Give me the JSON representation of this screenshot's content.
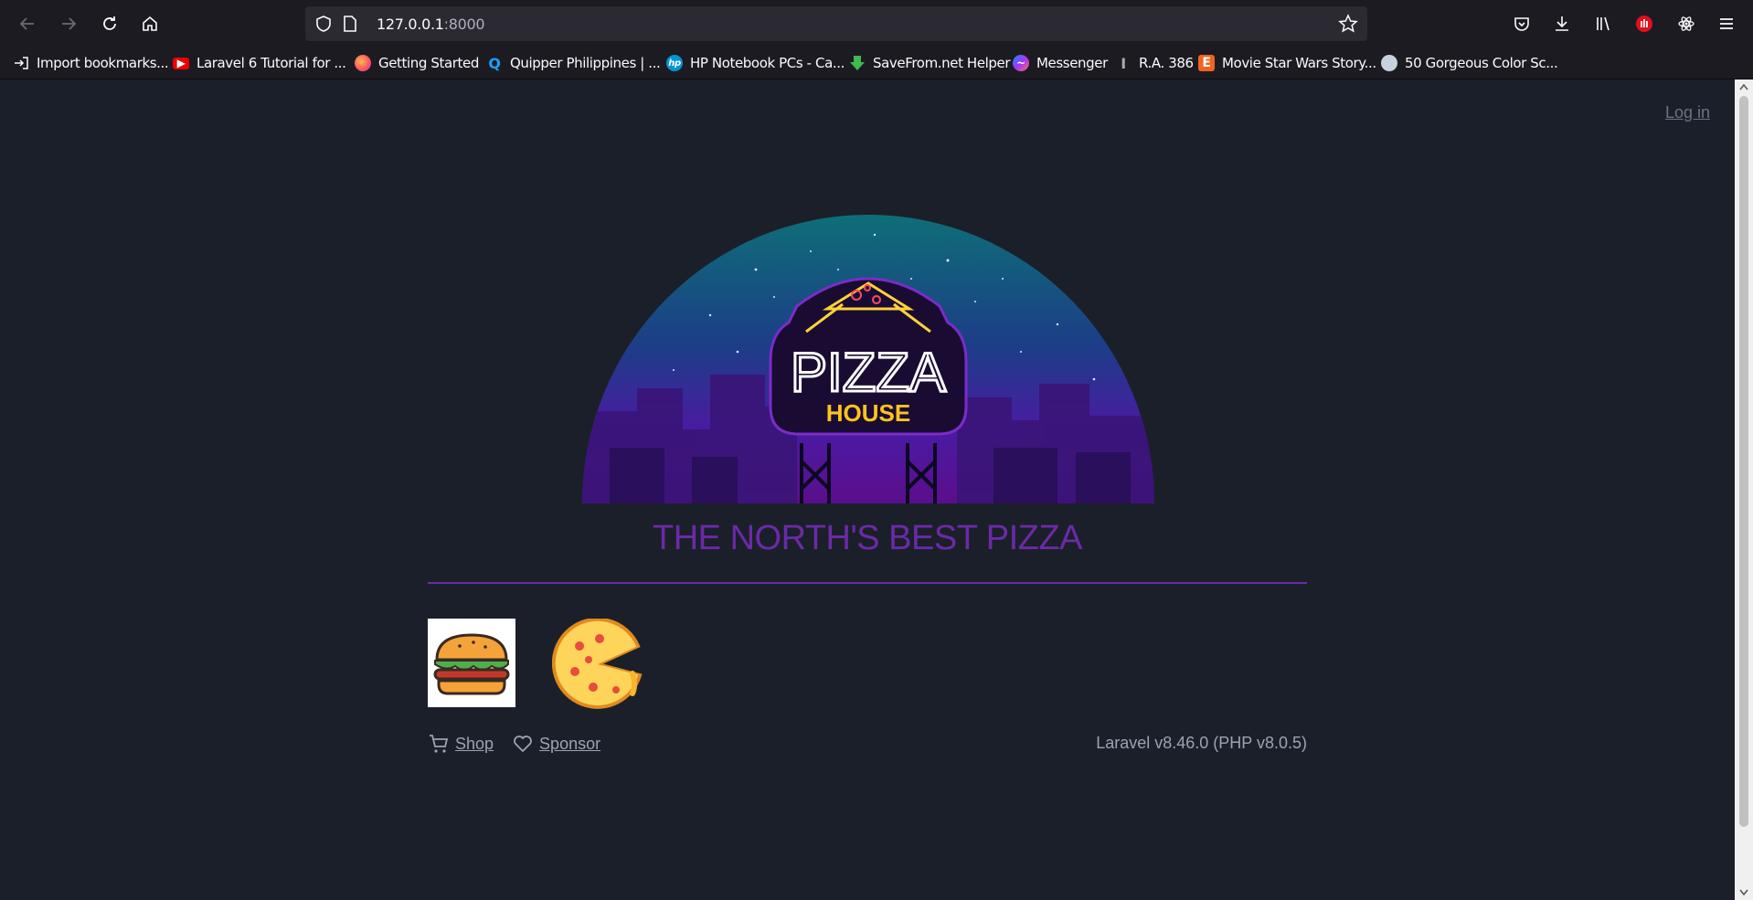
{
  "browser": {
    "url_host": "127.0.0.1",
    "url_port": ":8000",
    "bookmarks": [
      {
        "label": "Import bookmarks...",
        "icon": "import-icon"
      },
      {
        "label": "Laravel 6 Tutorial for ...",
        "icon": "youtube-icon"
      },
      {
        "label": "Getting Started",
        "icon": "firefox-icon"
      },
      {
        "label": "Quipper Philippines | ...",
        "icon": "quipper-icon"
      },
      {
        "label": "HP Notebook PCs - Ca...",
        "icon": "hp-icon"
      },
      {
        "label": "SaveFrom.net Helper",
        "icon": "download-arrow-icon"
      },
      {
        "label": "Messenger",
        "icon": "messenger-icon"
      },
      {
        "label": "R.A. 386",
        "icon": "text-cursor-icon"
      },
      {
        "label": "Movie Star Wars Story...",
        "icon": "etsy-icon"
      },
      {
        "label": "50 Gorgeous Color Sc...",
        "icon": "palette-icon"
      }
    ]
  },
  "page": {
    "login_label": "Log in",
    "hero": {
      "sign_top": "PIZZA",
      "sign_bottom": "HOUSE"
    },
    "tagline": "THE NORTH'S BEST PIZZA",
    "shop_label": "Shop",
    "sponsor_label": "Sponsor",
    "version": "Laravel v8.46.0 (PHP v8.0.5)"
  },
  "colors": {
    "accent": "#6b2aa8",
    "background": "#1b1f2a"
  }
}
